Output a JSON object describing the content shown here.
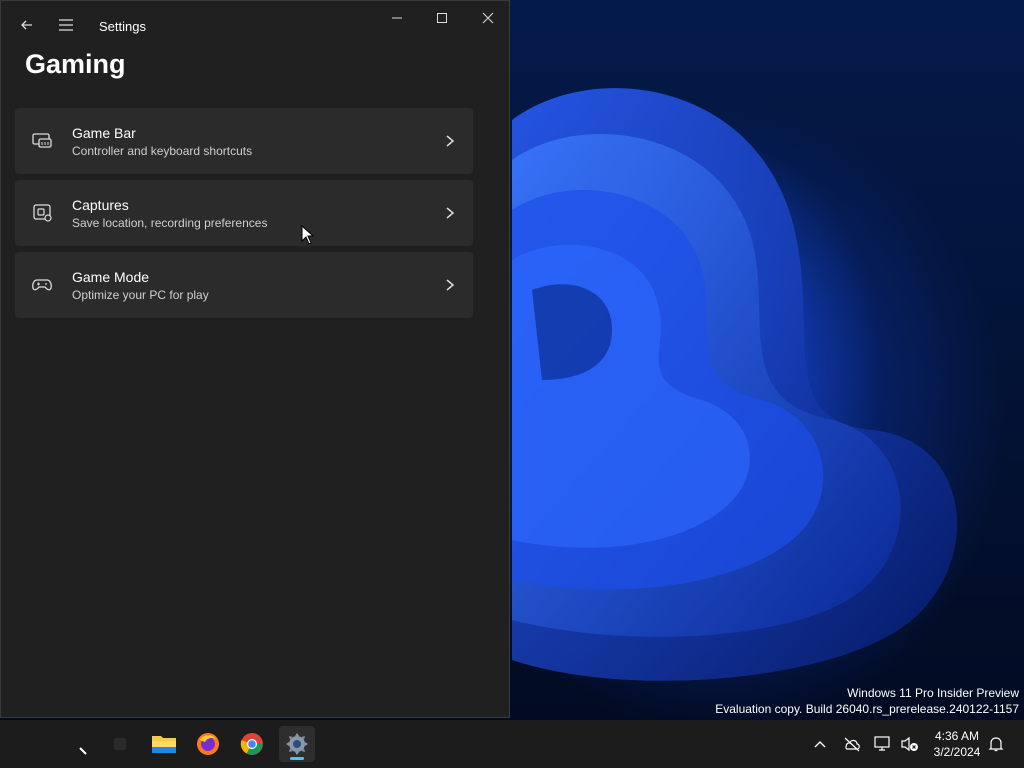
{
  "window": {
    "title": "Settings",
    "page_title": "Gaming"
  },
  "cards": [
    {
      "title": "Game Bar",
      "subtitle": "Controller and keyboard shortcuts",
      "icon": "game-bar-icon"
    },
    {
      "title": "Captures",
      "subtitle": "Save location, recording preferences",
      "icon": "captures-icon"
    },
    {
      "title": "Game Mode",
      "subtitle": "Optimize your PC for play",
      "icon": "game-mode-icon"
    }
  ],
  "watermark": {
    "line1": "Windows 11 Pro Insider Preview",
    "line2": "Evaluation copy. Build 26040.rs_prerelease.240122-1157"
  },
  "taskbar": {
    "apps": [
      "file-explorer",
      "firefox",
      "chrome",
      "settings"
    ],
    "active_app": "settings",
    "clock_time": "4:36 AM",
    "clock_date": "3/2/2024"
  },
  "colors": {
    "window_bg": "#202020",
    "card_bg": "#2b2b2b",
    "accent": "#4cc2ff",
    "taskbar_bg": "#1c1c1c"
  }
}
